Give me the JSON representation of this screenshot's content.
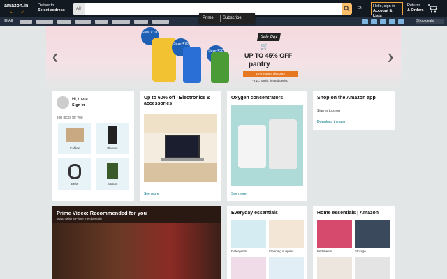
{
  "nav": {
    "logo_line1": "amazon.in",
    "deliver_line1": "Deliver to",
    "deliver_line2": "Select address",
    "search_category": "All",
    "search_placeholder": "",
    "flag": "EN",
    "account_line1": "Hello, sign in",
    "account_line2": "Account & Lists",
    "returns_line1": "Returns",
    "returns_line2": "& Orders",
    "cart_label": "Cart"
  },
  "subnav": {
    "all_label": "All",
    "right_label": "Shop deals"
  },
  "tooltip": {
    "left": "Prime",
    "right": "Subscribe"
  },
  "hero": {
    "badge1": "Save ₹100",
    "badge2": "Save ₹70",
    "badge3": "Save ₹30",
    "brand": "Sale Day",
    "offer": "UP TO 45% OFF",
    "category": "pantry",
    "bank": "10% instant discount",
    "note": "*T&C apply, limited period"
  },
  "card1": {
    "greeting": "Hi, there",
    "greeting_sub": "Sign in",
    "top_picks": "Top picks for you",
    "tiles": [
      "Cables",
      "Phones",
      "Belts",
      "Snacks"
    ]
  },
  "card2": {
    "title": "Up to 60% off | Electronics & accessories",
    "footer": "See more"
  },
  "card3": {
    "title": "Oxygen concentrators",
    "footer": "See more"
  },
  "card4": {
    "title": "Shop on the Amazon app",
    "text": "Sign in to shop",
    "link": "Download the app"
  },
  "card5": {
    "title": "Prime Video: Recommended for you",
    "sub": "Watch with a Prime membership"
  },
  "card6": {
    "title": "Everyday essentials",
    "captions": [
      "Detergents",
      "Cleaning supplies",
      "",
      ""
    ]
  },
  "card7": {
    "title": "Home essentials | Amazon",
    "captions": [
      "Bedsheets",
      "Storage",
      "",
      ""
    ]
  }
}
